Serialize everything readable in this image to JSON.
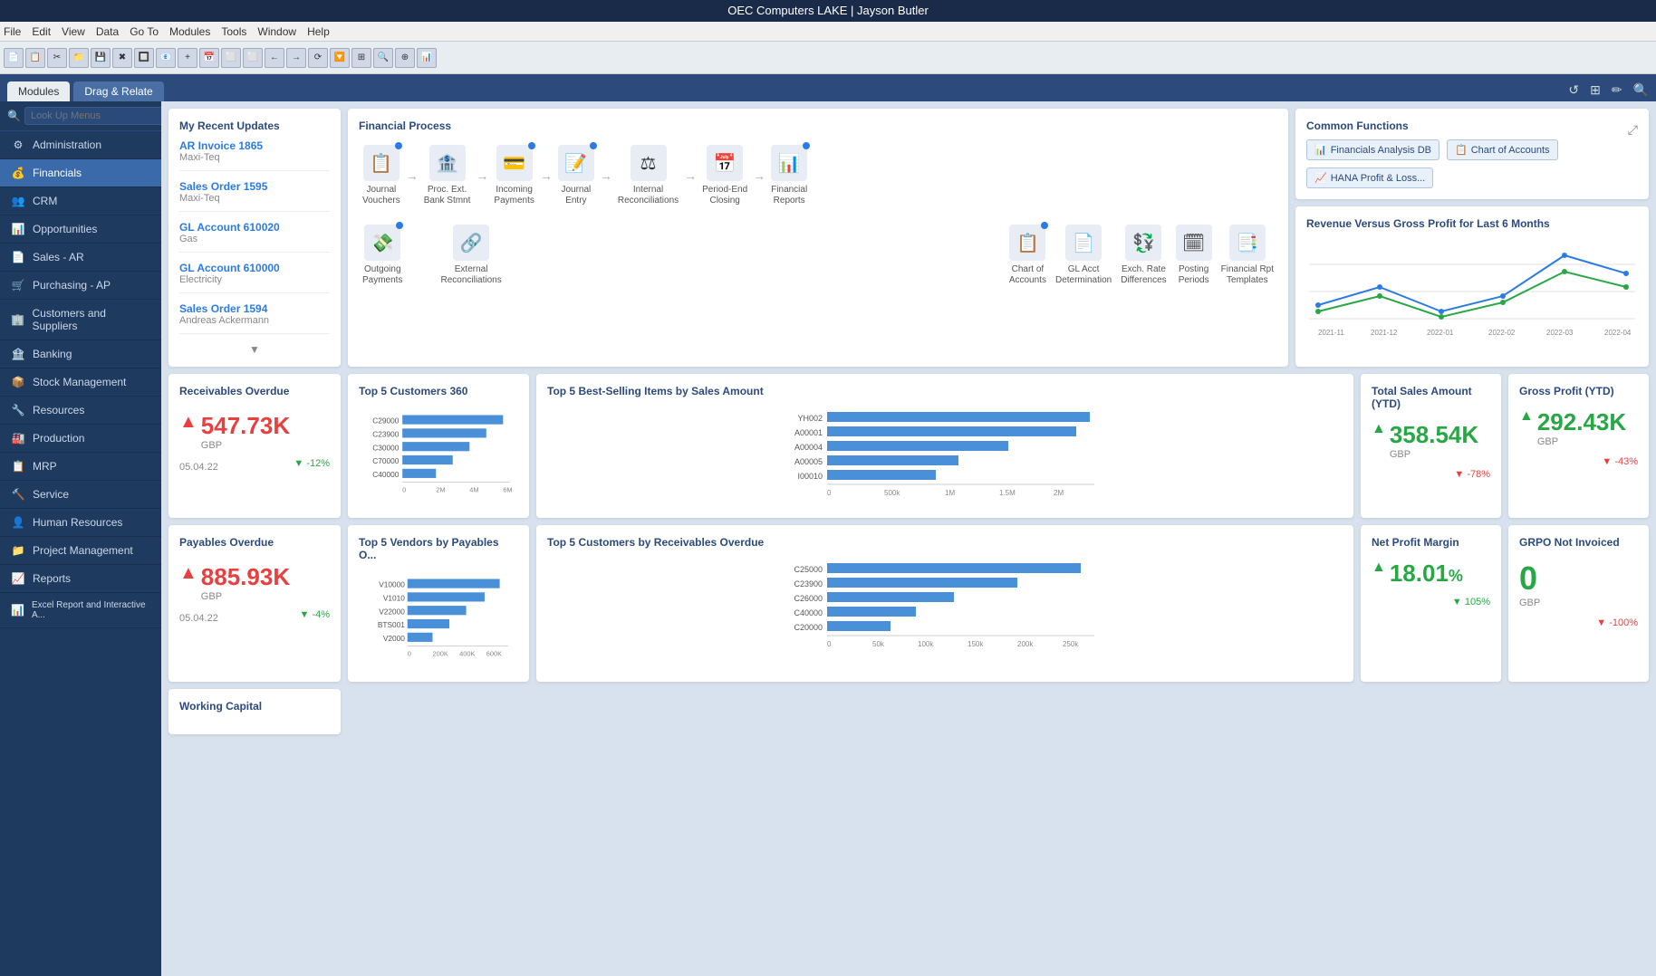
{
  "titleBar": {
    "text": "OEC Computers LAKE | Jayson Butler"
  },
  "menuBar": {
    "items": [
      "File",
      "Edit",
      "View",
      "Data",
      "Go To",
      "Modules",
      "Tools",
      "Window",
      "Help"
    ]
  },
  "navTabs": [
    {
      "label": "Modules",
      "active": true
    },
    {
      "label": "Drag & Relate",
      "active": false
    }
  ],
  "topbar": {
    "hamburger": "≡",
    "icons": [
      "↺",
      "⊞",
      "✏",
      "🔍"
    ]
  },
  "sidebar": {
    "searchPlaceholder": "Look Up Menus",
    "items": [
      {
        "label": "Administration",
        "icon": "⚙"
      },
      {
        "label": "Financials",
        "icon": "💰",
        "active": true
      },
      {
        "label": "CRM",
        "icon": "👥"
      },
      {
        "label": "Opportunities",
        "icon": "📊"
      },
      {
        "label": "Sales - AR",
        "icon": "📄"
      },
      {
        "label": "Purchasing - AP",
        "icon": "🛒"
      },
      {
        "label": "Customers and Suppliers",
        "icon": "🏢"
      },
      {
        "label": "Banking",
        "icon": "🏦"
      },
      {
        "label": "Stock Management",
        "icon": "📦"
      },
      {
        "label": "Resources",
        "icon": "🔧"
      },
      {
        "label": "Production",
        "icon": "🏭"
      },
      {
        "label": "MRP",
        "icon": "📋"
      },
      {
        "label": "Service",
        "icon": "🔨"
      },
      {
        "label": "Human Resources",
        "icon": "👤"
      },
      {
        "label": "Project Management",
        "icon": "📁"
      },
      {
        "label": "Reports",
        "icon": "📈"
      },
      {
        "label": "Excel Report and Interactive A...",
        "icon": "📊"
      }
    ]
  },
  "recentUpdates": {
    "title": "My Recent Updates",
    "items": [
      {
        "link": "AR Invoice 1865",
        "sub": "Maxi-Teq"
      },
      {
        "link": "Sales Order 1595",
        "sub": "Maxi-Teq"
      },
      {
        "link": "GL Account 610020",
        "sub": "Gas"
      },
      {
        "link": "GL Account 610000",
        "sub": "Electricity"
      },
      {
        "link": "Sales Order 1594",
        "sub": "Andreas Ackermann"
      }
    ]
  },
  "financialProcess": {
    "title": "Financial Process",
    "items": [
      {
        "label": "Journal\nVouchers",
        "icon": "📋",
        "hasDot": true
      },
      {
        "label": "Proc. Ext.\nBank Stmnt",
        "icon": "🏦",
        "hasDot": false
      },
      {
        "label": "Incoming\nPayments",
        "icon": "💳",
        "hasDot": true
      },
      {
        "label": "Journal\nEntry",
        "icon": "📝",
        "hasDot": true
      },
      {
        "label": "Internal\nReconciliations",
        "icon": "⚖",
        "hasDot": false
      },
      {
        "label": "Period-End\nClosing",
        "icon": "📅",
        "hasDot": false
      },
      {
        "label": "Financial\nReports",
        "icon": "📊",
        "hasDot": true
      },
      {
        "label": "Outgoing\nPayments",
        "icon": "💸",
        "hasDot": true
      },
      {
        "label": "External\nReconciliations",
        "icon": "🔗",
        "hasDot": false
      },
      {
        "label": "Chart of\nAccounts",
        "icon": "📋",
        "hasDot": true
      },
      {
        "label": "GL Acct\nDetermination",
        "icon": "📄",
        "hasDot": false
      },
      {
        "label": "Exch. Rate\nDifferences",
        "icon": "💱",
        "hasDot": false
      },
      {
        "label": "Posting\nPeriods",
        "icon": "🗓",
        "hasDot": false
      },
      {
        "label": "Financial Rpt\nTemplates",
        "icon": "📑",
        "hasDot": false
      }
    ]
  },
  "commonFunctions": {
    "title": "Common Functions",
    "links": [
      {
        "label": "Financials Analysis DB",
        "icon": "📊"
      },
      {
        "label": "Chart of Accounts",
        "icon": "📋"
      },
      {
        "label": "HANA Profit & Loss...",
        "icon": "📈"
      }
    ]
  },
  "revenueChart": {
    "title": "Revenue Versus Gross Profit for Last 6 Months",
    "labels": [
      "2021-11",
      "2021-12",
      "2022-01",
      "2022-02",
      "2022-03",
      "2022-04"
    ],
    "revenue": [
      30,
      45,
      25,
      35,
      80,
      60
    ],
    "grossProfit": [
      20,
      35,
      15,
      25,
      55,
      40
    ]
  },
  "receivablesOverdue": {
    "title": "Receivables Overdue",
    "value": "547.73K",
    "currency": "GBP",
    "date": "05.04.22",
    "change": "-12%",
    "changeDir": "down"
  },
  "top5Customers360": {
    "title": "Top 5 Customers 360",
    "items": [
      {
        "label": "C29000",
        "value": 90
      },
      {
        "label": "C23900",
        "value": 75
      },
      {
        "label": "C30000",
        "value": 60
      },
      {
        "label": "C70000",
        "value": 45
      },
      {
        "label": "C40000",
        "value": 30
      }
    ],
    "xLabels": [
      "0",
      "2M",
      "4M",
      "6M"
    ]
  },
  "top5BestSelling": {
    "title": "Top 5 Best-Selling Items by Sales Amount",
    "items": [
      {
        "label": "YH002",
        "value": 100
      },
      {
        "label": "A00001",
        "value": 95
      },
      {
        "label": "A00004",
        "value": 70
      },
      {
        "label": "A00005",
        "value": 50
      },
      {
        "label": "I00010",
        "value": 40
      }
    ],
    "xLabels": [
      "0",
      "500k",
      "1M",
      "1.5M",
      "2M"
    ]
  },
  "totalSales": {
    "title": "Total Sales Amount (YTD)",
    "value": "358.54K",
    "currency": "GBP",
    "change": "-78%",
    "changeDir": "down"
  },
  "grossProfit": {
    "title": "Gross Profit (YTD)",
    "value": "292.43K",
    "currency": "GBP",
    "change": "-43%",
    "changeDir": "down"
  },
  "payablesOverdue": {
    "title": "Payables Overdue",
    "value": "885.93K",
    "currency": "GBP",
    "date": "05.04.22",
    "change": "-4%",
    "changeDir": "down"
  },
  "top5Vendors": {
    "title": "Top 5 Vendors by Payables O...",
    "items": [
      {
        "label": "V10000",
        "value": 90
      },
      {
        "label": "V1010",
        "value": 75
      },
      {
        "label": "V22000",
        "value": 55
      },
      {
        "label": "BTS001",
        "value": 40
      },
      {
        "label": "V2000",
        "value": 25
      }
    ],
    "xLabels": [
      "0",
      "200K",
      "400K",
      "600K"
    ]
  },
  "top5CustomersReceivables": {
    "title": "Top 5 Customers by Receivables Overdue",
    "items": [
      {
        "label": "C25000",
        "value": 100
      },
      {
        "label": "C23900",
        "value": 75
      },
      {
        "label": "C26000",
        "value": 50
      },
      {
        "label": "C40000",
        "value": 35
      },
      {
        "label": "C20000",
        "value": 25
      }
    ],
    "xLabels": [
      "0",
      "50k",
      "100k",
      "150k",
      "200k",
      "250k"
    ]
  },
  "netProfitMargin": {
    "title": "Net Profit Margin",
    "value": "18.01",
    "unit": "%",
    "change": "105%",
    "changeDir": "up"
  },
  "grpoNotInvoiced": {
    "title": "GRPO Not Invoiced",
    "value": "0",
    "currency": "GBP",
    "change": "-100%",
    "changeDir": "down"
  },
  "workingCapital": {
    "title": "Working Capital"
  }
}
